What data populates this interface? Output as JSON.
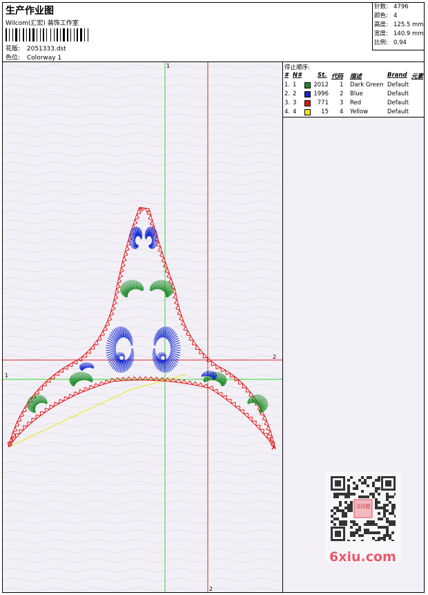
{
  "header": {
    "title": "生产作业图",
    "software": "Wilcom(汇宏) 装饰工作室",
    "file_label": "花版:",
    "file_name": "2051333.dst",
    "colorway_label": "色位:",
    "colorway": "Colorway 1"
  },
  "stats": {
    "stitches_label": "针数:",
    "stitches": "4796",
    "colors_label": "颜色:",
    "colors": "4",
    "height_label": "高度:",
    "height": "125.5 mm",
    "width_label": "宽度:",
    "width": "140.9 mm",
    "scale_label": "比例:",
    "scale": "0.94"
  },
  "legend": {
    "stop_label": "停止顺序:",
    "headers": [
      "#",
      "N#",
      "St.",
      "代码",
      "描述",
      "Brand",
      "元素"
    ],
    "rows": [
      {
        "idx": "1.",
        "n": "1",
        "color": "#1e8c28",
        "st": "2012",
        "code": "1",
        "desc": "Dark Green",
        "brand": "Default"
      },
      {
        "idx": "2.",
        "n": "2",
        "color": "#1428d2",
        "st": "1996",
        "code": "2",
        "desc": "Blue",
        "brand": "Default"
      },
      {
        "idx": "3.",
        "n": "3",
        "color": "#e61414",
        "st": "771",
        "code": "3",
        "desc": "Red",
        "brand": "Default"
      },
      {
        "idx": "4.",
        "n": "4",
        "color": "#f0e614",
        "st": "15",
        "code": "4",
        "desc": "Yellow",
        "brand": "Default"
      }
    ]
  },
  "guides": {
    "green_vertical_label": "1",
    "green_horizontal_label": "1",
    "red_vertical_label": "2",
    "red_horizontal_label": "2"
  },
  "watermark": {
    "text": "6xiu.com",
    "stamp_text": "汉闪图"
  },
  "colors": {
    "green": "#1e8c28",
    "blue": "#1428d2",
    "red": "#e61414",
    "yellow": "#f0e614",
    "guide_green": "#33d633",
    "guide_red": "#d62828"
  }
}
